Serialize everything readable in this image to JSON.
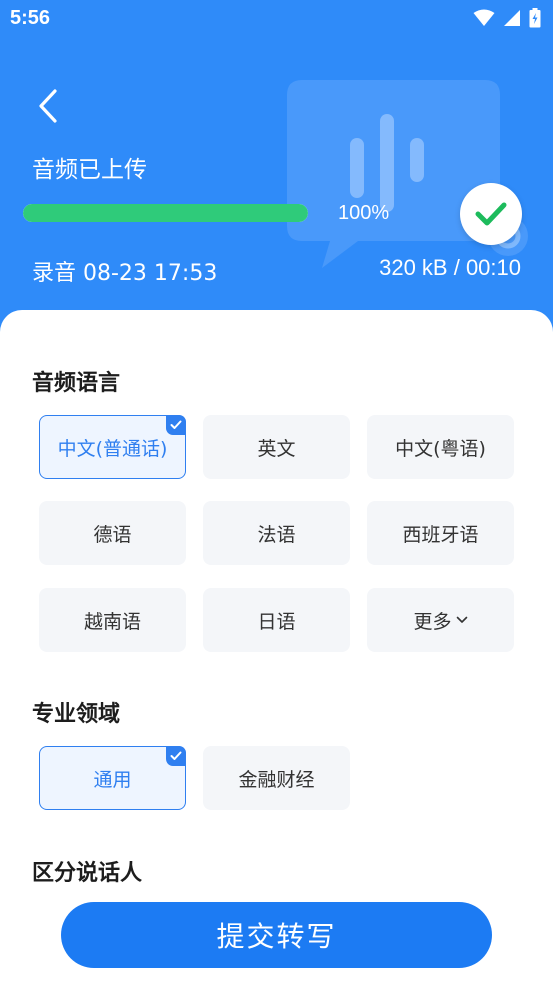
{
  "status_bar": {
    "time": "5:56",
    "icons": [
      "wifi-icon",
      "signal-icon",
      "battery-icon"
    ]
  },
  "header": {
    "upload_title": "音频已上传",
    "progress_percent_label": "100%",
    "progress_fraction": 1.0,
    "record_info": "录音 08-23 17:53",
    "file_meta": "320 kB /  00:10"
  },
  "audio_language": {
    "title": "音频语言",
    "options": [
      {
        "label": "中文(普通话)",
        "selected": true
      },
      {
        "label": "英文",
        "selected": false
      },
      {
        "label": "中文(粤语)",
        "selected": false
      },
      {
        "label": "德语",
        "selected": false
      },
      {
        "label": "法语",
        "selected": false
      },
      {
        "label": "西班牙语",
        "selected": false
      },
      {
        "label": "越南语",
        "selected": false
      },
      {
        "label": "日语",
        "selected": false
      },
      {
        "label": "更多",
        "selected": false
      }
    ]
  },
  "domain": {
    "title": "专业领域",
    "options": [
      {
        "label": "通用",
        "selected": true
      },
      {
        "label": "金融财经",
        "selected": false
      }
    ]
  },
  "speaker": {
    "title": "区分说话人"
  },
  "submit_label": "提交转写",
  "colors": {
    "header_blue": "#2f8bf9",
    "progress_green": "#2fcb7a",
    "accent_blue": "#2f7ff0",
    "button_blue": "#1c7bf3"
  }
}
